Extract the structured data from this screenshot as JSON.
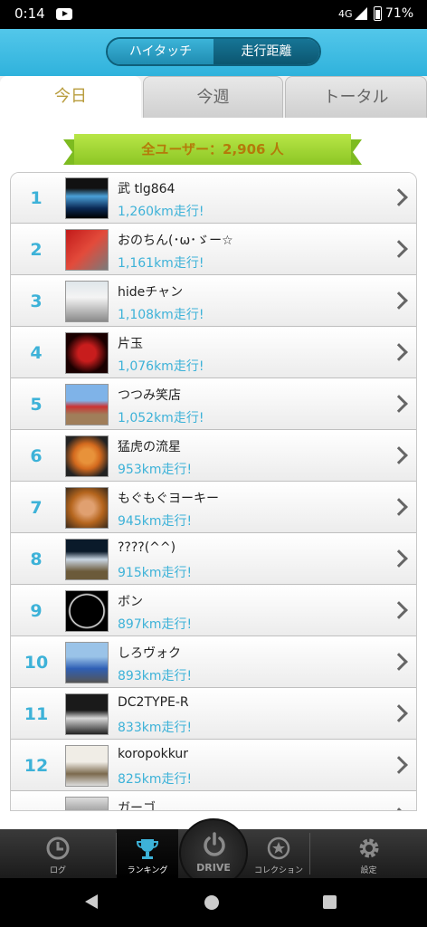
{
  "status": {
    "time": "0:14",
    "network": "4G",
    "battery": "71%"
  },
  "header": {
    "seg_left": "ハイタッチ",
    "seg_right": "走行距離"
  },
  "tabs": [
    "今日",
    "今週",
    "トータル"
  ],
  "banner": "全ユーザー：2,906 人",
  "rankings": [
    {
      "rank": "1",
      "name": "武 tlg864",
      "distance": "1,260km走行!"
    },
    {
      "rank": "2",
      "name": "おのちん(･ω･ゞー☆",
      "distance": "1,161km走行!"
    },
    {
      "rank": "3",
      "name": "hideチャン",
      "distance": "1,108km走行!"
    },
    {
      "rank": "4",
      "name": "片玉",
      "distance": "1,076km走行!"
    },
    {
      "rank": "5",
      "name": "つつみ笑店",
      "distance": "1,052km走行!"
    },
    {
      "rank": "6",
      "name": "猛虎の流星",
      "distance": "953km走行!"
    },
    {
      "rank": "7",
      "name": "もぐもぐヨーキー",
      "distance": "945km走行!"
    },
    {
      "rank": "8",
      "name": "????(^^)",
      "distance": "915km走行!"
    },
    {
      "rank": "9",
      "name": "ボン",
      "distance": "897km走行!"
    },
    {
      "rank": "10",
      "name": "しろヴォク",
      "distance": "893km走行!"
    },
    {
      "rank": "11",
      "name": "DC2TYPE-R",
      "distance": "833km走行!"
    },
    {
      "rank": "12",
      "name": "koropokkur",
      "distance": "825km走行!"
    },
    {
      "rank": "",
      "name": "ガーゴ",
      "distance": ""
    }
  ],
  "nav": {
    "log": "ログ",
    "ranking": "ランキング",
    "drive": "DRIVE",
    "collection": "コレクション",
    "settings": "設定"
  },
  "colors": {
    "accent": "#3db2d8",
    "header": "#2fb2dc",
    "banner": "#8cc625"
  }
}
